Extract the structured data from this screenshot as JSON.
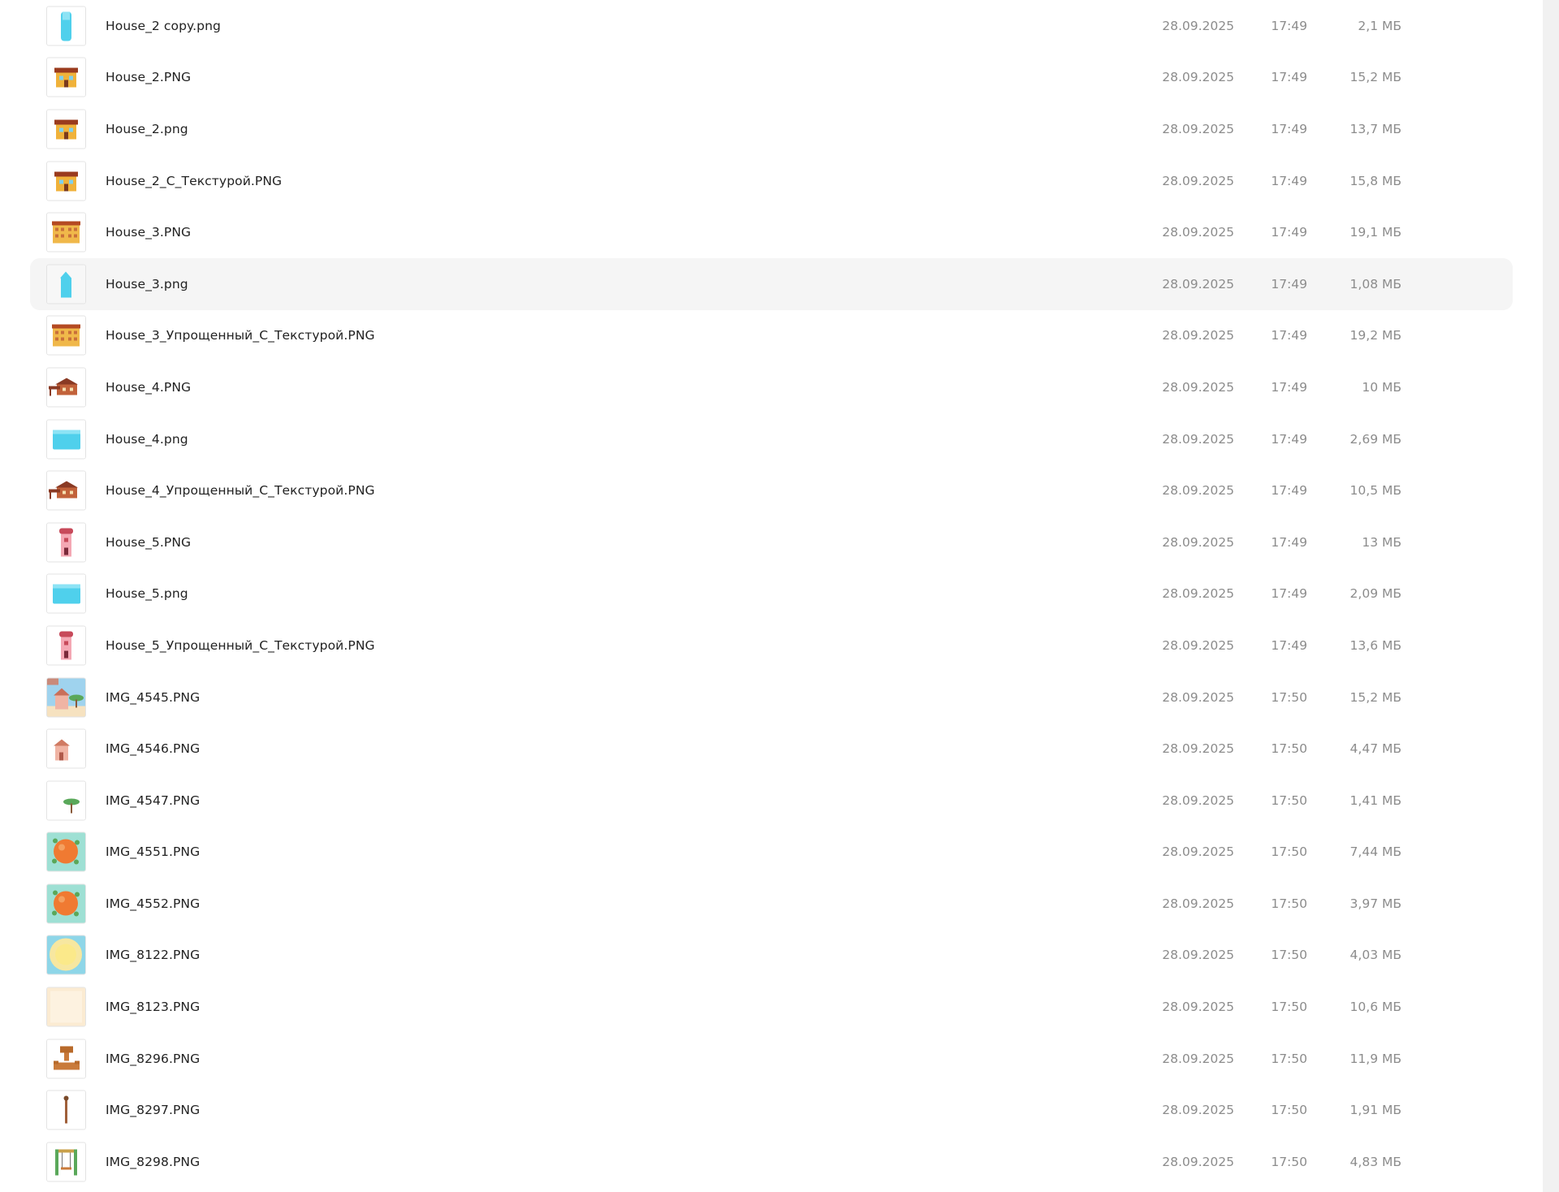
{
  "files": [
    {
      "name": "House_2 copy.png",
      "date": "28.09.2025",
      "time": "17:49",
      "size": "2,1 МБ",
      "thumb": "blue-tower-icon",
      "selected": false
    },
    {
      "name": "House_2.PNG",
      "date": "28.09.2025",
      "time": "17:49",
      "size": "15,2 МБ",
      "thumb": "orange-house-icon",
      "selected": false
    },
    {
      "name": "House_2.png",
      "date": "28.09.2025",
      "time": "17:49",
      "size": "13,7 МБ",
      "thumb": "orange-house-icon",
      "selected": false
    },
    {
      "name": "House_2_С_Текстурой.PNG",
      "date": "28.09.2025",
      "time": "17:49",
      "size": "15,8 МБ",
      "thumb": "orange-house-icon",
      "selected": false
    },
    {
      "name": "House_3.PNG",
      "date": "28.09.2025",
      "time": "17:49",
      "size": "19,1 МБ",
      "thumb": "long-building-icon",
      "selected": false
    },
    {
      "name": "House_3.png",
      "date": "28.09.2025",
      "time": "17:49",
      "size": "1,08 МБ",
      "thumb": "blue-arrow-icon",
      "selected": true
    },
    {
      "name": "House_3_Упрощенный_С_Текстурой.PNG",
      "date": "28.09.2025",
      "time": "17:49",
      "size": "19,2 МБ",
      "thumb": "long-building-icon",
      "selected": false
    },
    {
      "name": "House_4.PNG",
      "date": "28.09.2025",
      "time": "17:49",
      "size": "10 МБ",
      "thumb": "brick-house-icon",
      "selected": false
    },
    {
      "name": "House_4.png",
      "date": "28.09.2025",
      "time": "17:49",
      "size": "2,69 МБ",
      "thumb": "blue-box-icon",
      "selected": false
    },
    {
      "name": "House_4_Упрощенный_С_Текстурой.PNG",
      "date": "28.09.2025",
      "time": "17:49",
      "size": "10,5 МБ",
      "thumb": "brick-house-icon",
      "selected": false
    },
    {
      "name": "House_5.PNG",
      "date": "28.09.2025",
      "time": "17:49",
      "size": "13 МБ",
      "thumb": "pink-tower-icon",
      "selected": false
    },
    {
      "name": "House_5.png",
      "date": "28.09.2025",
      "time": "17:49",
      "size": "2,09 МБ",
      "thumb": "blue-box-icon",
      "selected": false
    },
    {
      "name": "House_5_Упрощенный_С_Текстурой.PNG",
      "date": "28.09.2025",
      "time": "17:49",
      "size": "13,6 МБ",
      "thumb": "pink-tower-icon",
      "selected": false
    },
    {
      "name": "IMG_4545.PNG",
      "date": "28.09.2025",
      "time": "17:50",
      "size": "15,2 МБ",
      "thumb": "scene-house-tree-icon",
      "selected": false
    },
    {
      "name": "IMG_4546.PNG",
      "date": "28.09.2025",
      "time": "17:50",
      "size": "4,47 МБ",
      "thumb": "small-pink-house-icon",
      "selected": false
    },
    {
      "name": "IMG_4547.PNG",
      "date": "28.09.2025",
      "time": "17:50",
      "size": "1,41 МБ",
      "thumb": "small-tree-icon",
      "selected": false
    },
    {
      "name": "IMG_4551.PNG",
      "date": "28.09.2025",
      "time": "17:50",
      "size": "7,44 МБ",
      "thumb": "orange-planet-icon",
      "selected": false
    },
    {
      "name": "IMG_4552.PNG",
      "date": "28.09.2025",
      "time": "17:50",
      "size": "3,97 МБ",
      "thumb": "orange-planet-icon",
      "selected": false
    },
    {
      "name": "IMG_8122.PNG",
      "date": "28.09.2025",
      "time": "17:50",
      "size": "4,03 МБ",
      "thumb": "yellow-sun-icon",
      "selected": false
    },
    {
      "name": "IMG_8123.PNG",
      "date": "28.09.2025",
      "time": "17:50",
      "size": "10,6 МБ",
      "thumb": "cream-paper-icon",
      "selected": false
    },
    {
      "name": "IMG_8296.PNG",
      "date": "28.09.2025",
      "time": "17:50",
      "size": "11,9 МБ",
      "thumb": "wooden-object-icon",
      "selected": false
    },
    {
      "name": "IMG_8297.PNG",
      "date": "28.09.2025",
      "time": "17:50",
      "size": "1,91 МБ",
      "thumb": "thin-post-icon",
      "selected": false
    },
    {
      "name": "IMG_8298.PNG",
      "date": "28.09.2025",
      "time": "17:50",
      "size": "4,83 МБ",
      "thumb": "swing-icon",
      "selected": false
    }
  ]
}
